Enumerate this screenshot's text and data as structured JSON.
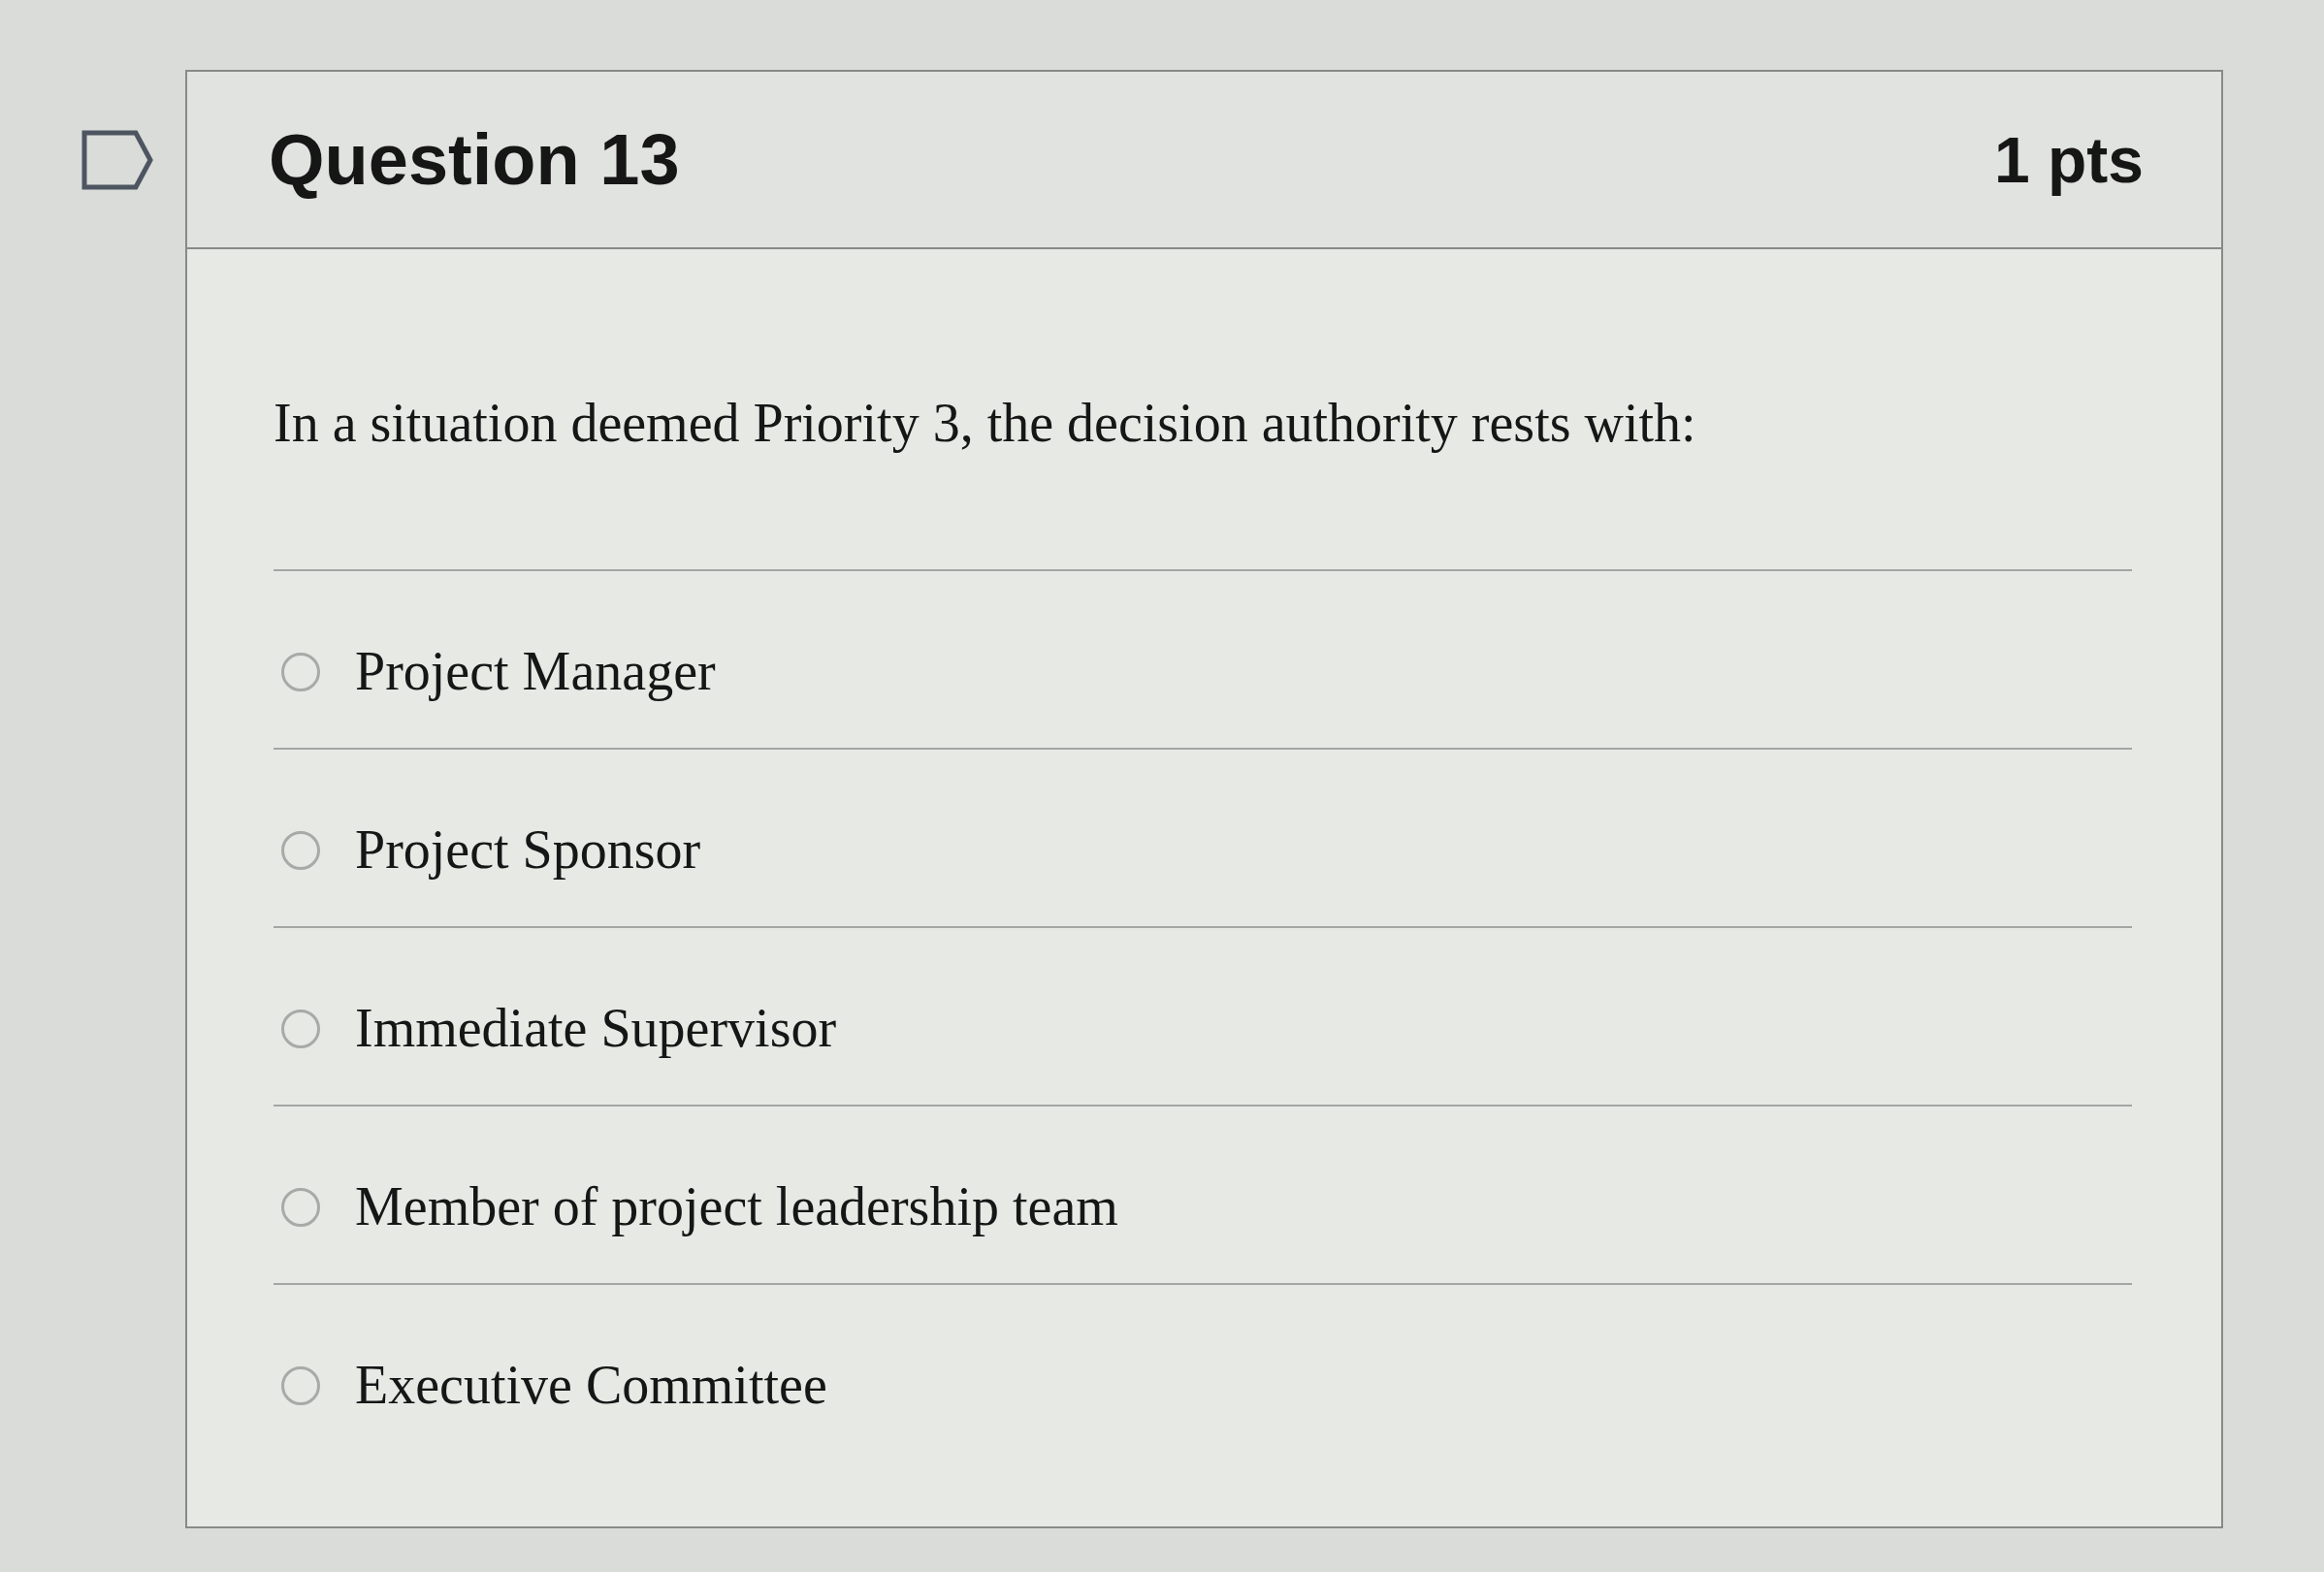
{
  "question": {
    "title": "Question 13",
    "points": "1 pts",
    "flagged": false
  },
  "prompt": "In a situation deemed Priority 3, the decision authority rests with:",
  "answers": [
    {
      "label": "Project Manager",
      "selected": false
    },
    {
      "label": "Project Sponsor",
      "selected": false
    },
    {
      "label": "Immediate Supervisor",
      "selected": false
    },
    {
      "label": "Member of project leadership team",
      "selected": false
    },
    {
      "label": "Executive Committee",
      "selected": false
    }
  ]
}
